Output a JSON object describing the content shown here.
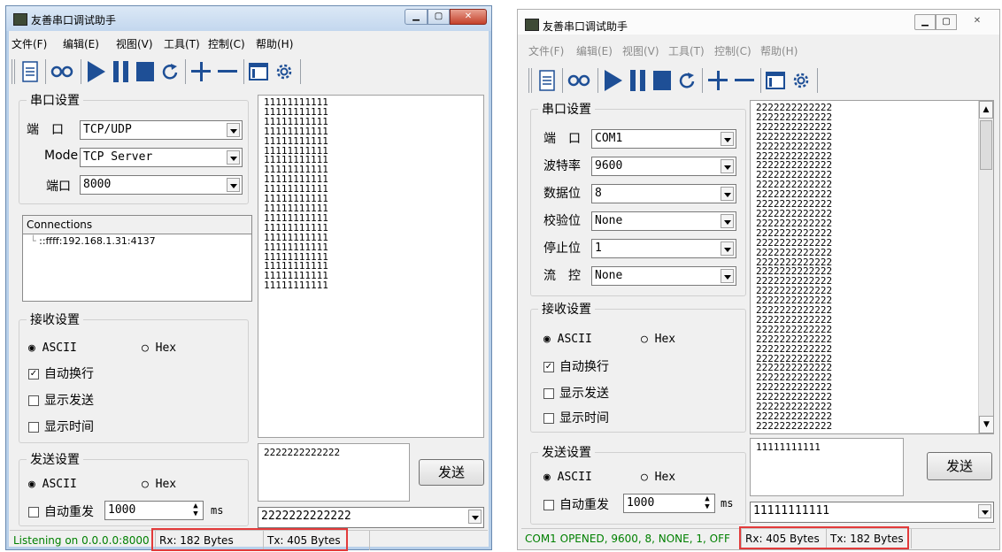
{
  "left": {
    "title": "友善串口调试助手",
    "menu": [
      "文件(F)",
      "编辑(E)",
      "视图(V)",
      "工具(T)",
      "控制(C)",
      "帮助(H)"
    ],
    "serial_group_title": "串口设置",
    "port_label": "端　口",
    "port_value": "TCP/UDP",
    "mode_label": "Mode",
    "mode_value": "TCP Server",
    "portno_label": "端口",
    "portno_value": "8000",
    "connections_header": "Connections",
    "connection_item": "::ffff:192.168.1.31:4137",
    "recv_group_title": "接收设置",
    "ascii_label": "ASCII",
    "hex_label": "Hex",
    "autowrap_label": "自动换行",
    "showsend_label": "显示发送",
    "showtime_label": "显示时间",
    "send_group_title": "发送设置",
    "send_ascii_label": "ASCII",
    "send_hex_label": "Hex",
    "autorepeat_label": "自动重发",
    "interval_value": "1000",
    "interval_unit": "ms",
    "receive_lines": [
      "11111111111",
      "11111111111",
      "11111111111",
      "11111111111",
      "11111111111",
      "11111111111",
      "11111111111",
      "11111111111",
      "11111111111",
      "11111111111",
      "11111111111",
      "11111111111",
      "11111111111",
      "11111111111",
      "11111111111",
      "11111111111",
      "11111111111",
      "11111111111",
      "11111111111",
      "11111111111"
    ],
    "send_text": "2222222222222",
    "send_button": "发送",
    "history_value": "2222222222222",
    "status_text": "Listening on 0.0.0.0:8000",
    "rx_text": "Rx: 182 Bytes",
    "tx_text": "Tx: 405 Bytes",
    "status_color": "#008000"
  },
  "right": {
    "title": "友善串口调试助手",
    "menu": [
      "文件(F)",
      "编辑(E)",
      "视图(V)",
      "工具(T)",
      "控制(C)",
      "帮助(H)"
    ],
    "serial_group_title": "串口设置",
    "port_label": "端　口",
    "port_value": "COM1",
    "baud_label": "波特率",
    "baud_value": "9600",
    "databits_label": "数据位",
    "databits_value": "8",
    "parity_label": "校验位",
    "parity_value": "None",
    "stopbits_label": "停止位",
    "stopbits_value": "1",
    "flow_label": "流　控",
    "flow_value": "None",
    "recv_group_title": "接收设置",
    "ascii_label": "ASCII",
    "hex_label": "Hex",
    "autowrap_label": "自动换行",
    "showsend_label": "显示发送",
    "showtime_label": "显示时间",
    "send_group_title": "发送设置",
    "send_ascii_label": "ASCII",
    "send_hex_label": "Hex",
    "autorepeat_label": "自动重发",
    "interval_value": "1000",
    "interval_unit": "ms",
    "receive_lines": [
      "2222222222222",
      "2222222222222",
      "2222222222222",
      "2222222222222",
      "2222222222222",
      "2222222222222",
      "2222222222222",
      "2222222222222",
      "2222222222222",
      "2222222222222",
      "2222222222222",
      "2222222222222",
      "2222222222222",
      "2222222222222",
      "2222222222222",
      "2222222222222",
      "2222222222222",
      "2222222222222",
      "2222222222222",
      "2222222222222",
      "2222222222222",
      "2222222222222",
      "2222222222222",
      "2222222222222",
      "2222222222222",
      "2222222222222",
      "2222222222222",
      "2222222222222",
      "2222222222222",
      "2222222222222",
      "2222222222222",
      "2222222222222",
      "2222222222222",
      "2222222222222"
    ],
    "send_text": "11111111111",
    "send_button": "发送",
    "history_value": "11111111111",
    "status_text": "COM1 OPENED, 9600, 8, NONE, 1, OFF",
    "rx_text": "Rx: 405 Bytes",
    "tx_text": "Tx: 182 Bytes",
    "status_color": "#008000"
  }
}
